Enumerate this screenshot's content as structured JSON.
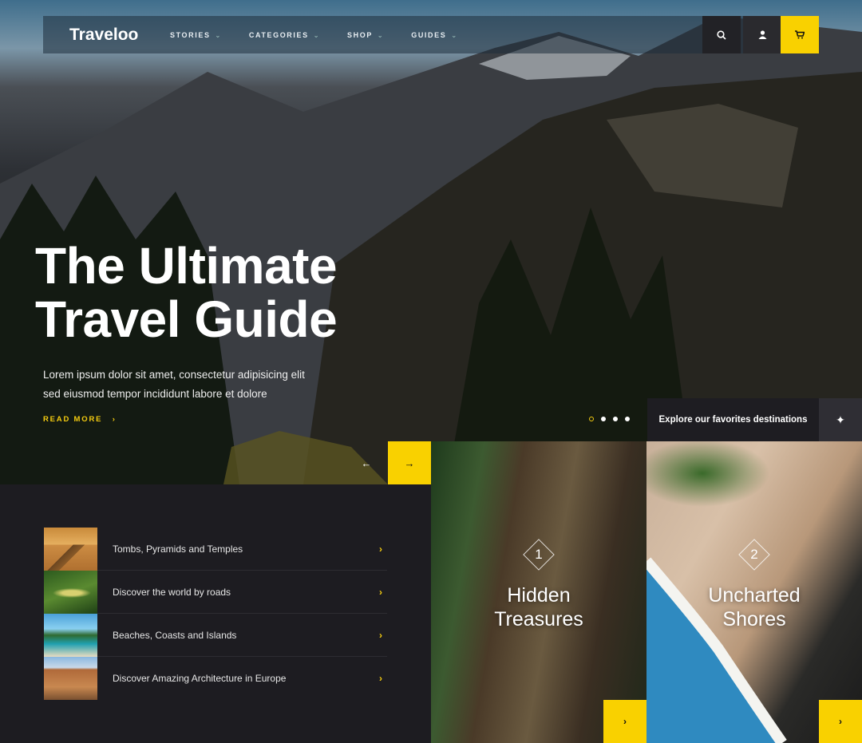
{
  "nav": {
    "logo": "Traveloo",
    "items": [
      {
        "label": "STORIES"
      },
      {
        "label": "CATEGORIES"
      },
      {
        "label": "SHOP"
      },
      {
        "label": "GUIDES"
      }
    ],
    "icons": [
      "search-icon",
      "user-icon",
      "cart-icon"
    ]
  },
  "hero": {
    "title_line1": "The Ultimate",
    "title_line2": "Travel Guide",
    "description": "Lorem ipsum dolor sit amet, consectetur adipisicing elit sed eiusmod tempor incididunt labore et dolore",
    "read_more": "READ MORE",
    "slides": 4,
    "active_slide": 1
  },
  "explore": {
    "label": "Explore our favorites destinations"
  },
  "list": [
    {
      "label": "Tombs, Pyramids and Temples"
    },
    {
      "label": "Discover the world by roads"
    },
    {
      "label": "Beaches, Coasts and Islands"
    },
    {
      "label": "Discover Amazing Architecture in Europe"
    }
  ],
  "cards": [
    {
      "number": "1",
      "title_line1": "Hidden",
      "title_line2": "Treasures"
    },
    {
      "number": "2",
      "title_line1": "Uncharted",
      "title_line2": "Shores"
    }
  ],
  "colors": {
    "accent": "#f9d100",
    "panel": "#1d1c21"
  }
}
